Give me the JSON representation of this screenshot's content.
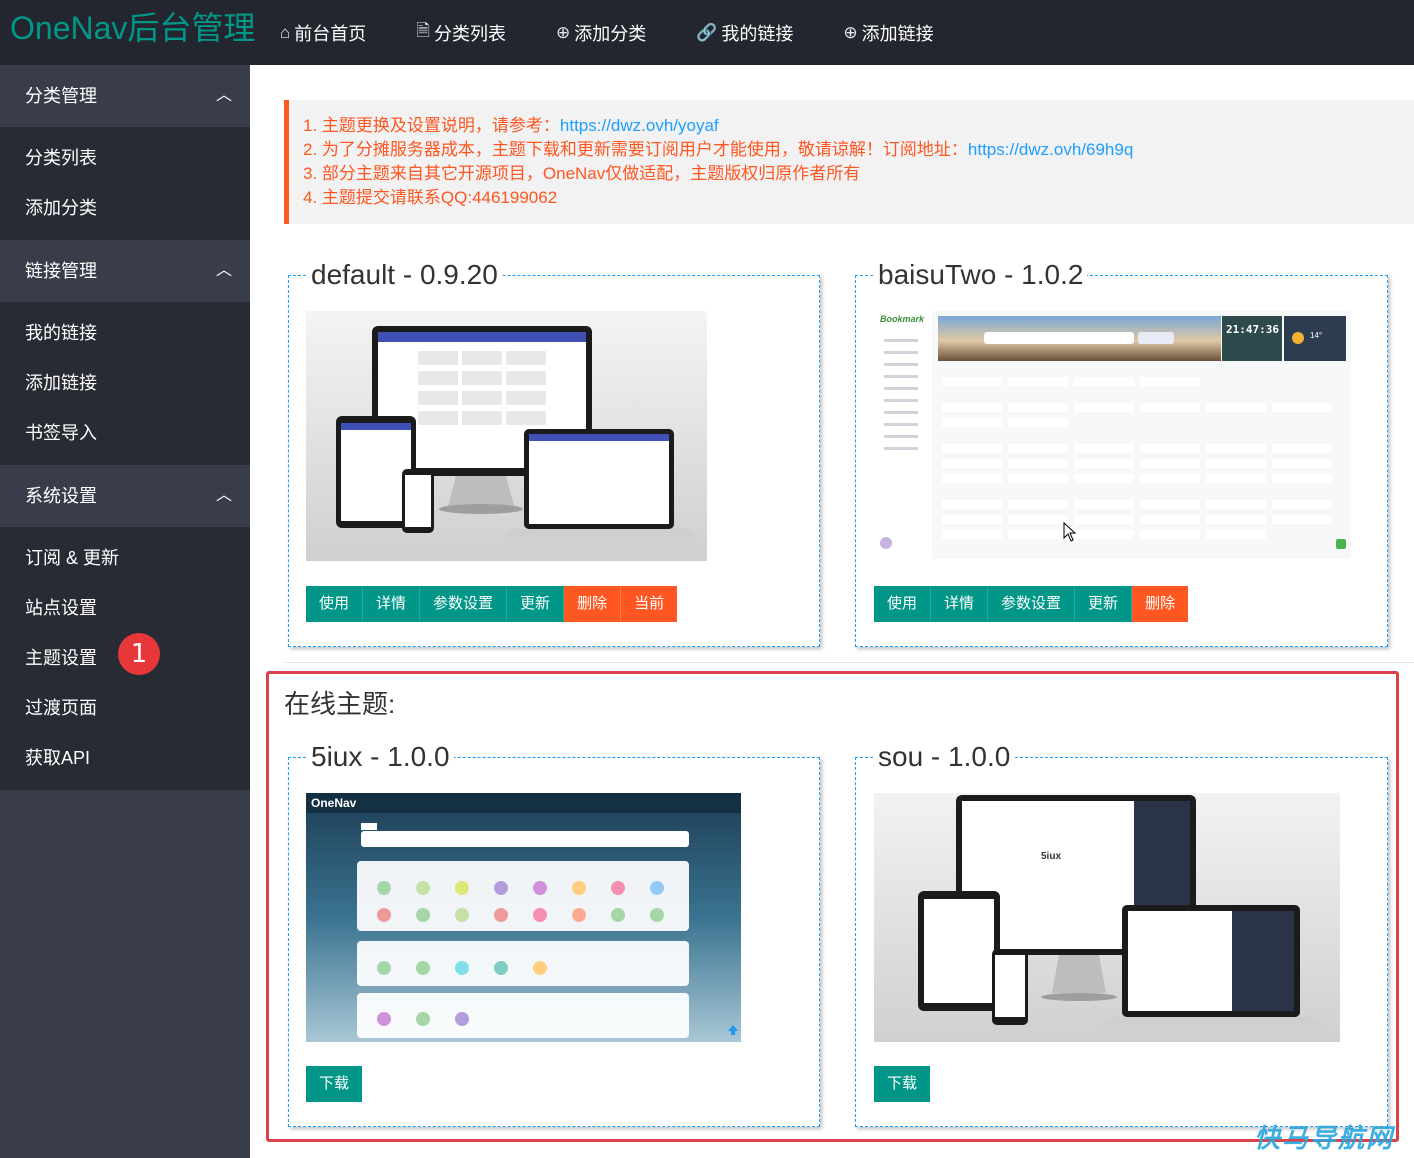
{
  "header": {
    "logo": "OneNav后台管理",
    "nav": [
      {
        "label": "前台首页",
        "icon": "home-icon"
      },
      {
        "label": "分类列表",
        "icon": "document-icon"
      },
      {
        "label": "添加分类",
        "icon": "plus-circle-icon"
      },
      {
        "label": "我的链接",
        "icon": "link-icon"
      },
      {
        "label": "添加链接",
        "icon": "plus-circle-icon"
      }
    ]
  },
  "sidebar": {
    "groups": [
      {
        "title": "分类管理",
        "items": [
          "分类列表",
          "添加分类"
        ]
      },
      {
        "title": "链接管理",
        "items": [
          "我的链接",
          "添加链接",
          "书签导入"
        ]
      },
      {
        "title": "系统设置",
        "items": [
          "订阅 & 更新",
          "站点设置",
          "主题设置",
          "过渡页面",
          "获取API"
        ]
      }
    ],
    "badge": "1"
  },
  "notice": {
    "line1_text": "1. 主题更换及设置说明，请参考：",
    "line1_link": "https://dwz.ovh/yoyaf",
    "line2_text": "2. 为了分摊服务器成本，主题下载和更新需要订阅用户才能使用，敬请谅解！订阅地址：",
    "line2_link": "https://dwz.ovh/69h9q",
    "line3": "3. 部分主题来自其它开源项目，OneNav仅做适配，主题版权归原作者所有",
    "line4": "4. 主题提交请联系QQ:446199062"
  },
  "installed_themes": [
    {
      "name": "default - 0.9.20",
      "buttons": [
        "使用",
        "详情",
        "参数设置",
        "更新",
        "删除",
        "当前"
      ]
    },
    {
      "name": "baisuTwo - 1.0.2",
      "buttons": [
        "使用",
        "详情",
        "参数设置",
        "更新",
        "删除"
      ]
    }
  ],
  "online": {
    "title": "在线主题:",
    "themes": [
      {
        "name": "5iux - 1.0.0",
        "button": "下载",
        "brand": "OneNav"
      },
      {
        "name": "sou - 1.0.0",
        "button": "下载",
        "brand": "5iux"
      }
    ]
  },
  "baisu_preview": {
    "brand": "Bookmark",
    "time": "21:47:36",
    "temp": "14°"
  },
  "watermark": "快马导航网",
  "colors": {
    "header_bg": "#23262e",
    "sidebar_bg": "#393d49",
    "sidebar_sub_bg": "#282b33",
    "accent": "#009688",
    "danger": "#ff5722",
    "link": "#1e9fff",
    "highlight_border": "#d9414b"
  }
}
